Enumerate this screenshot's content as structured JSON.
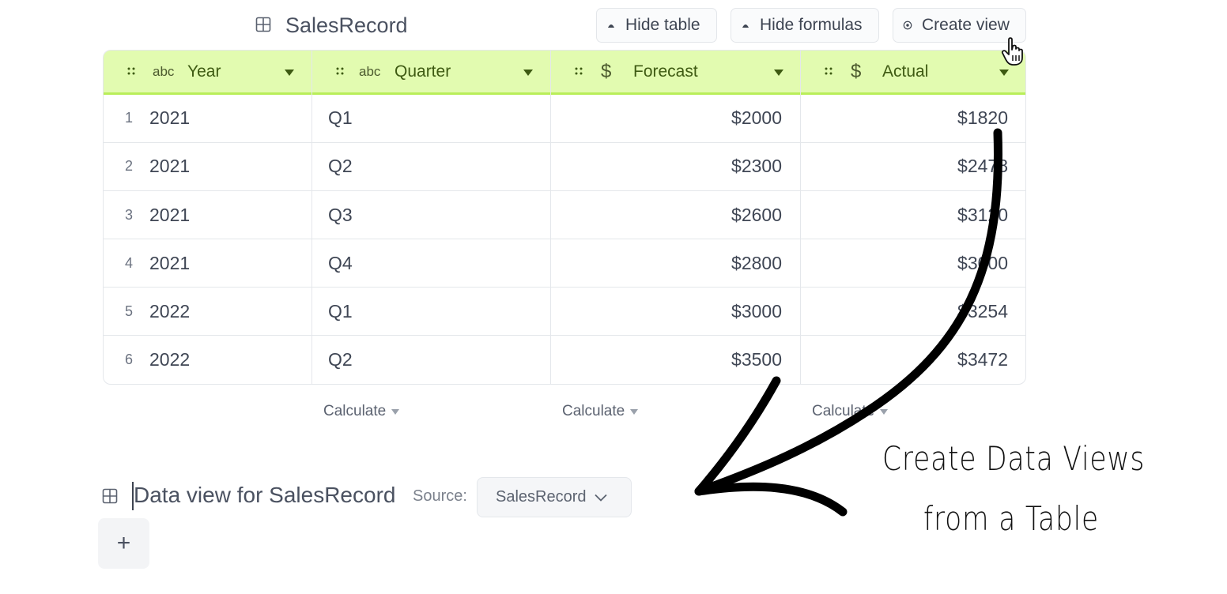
{
  "table": {
    "title": "SalesRecord",
    "buttons": {
      "hide_table": "Hide table",
      "hide_formulas": "Hide formulas",
      "create_view": "Create view"
    },
    "columns": [
      {
        "type_label": "abc",
        "type_icon": "text-type",
        "name": "Year"
      },
      {
        "type_label": "abc",
        "type_icon": "text-type",
        "name": "Quarter"
      },
      {
        "type_label": "$",
        "type_icon": "currency-type",
        "name": "Forecast"
      },
      {
        "type_label": "$",
        "type_icon": "currency-type",
        "name": "Actual"
      }
    ],
    "rows": [
      {
        "n": "1",
        "year": "2021",
        "quarter": "Q1",
        "forecast": "$2000",
        "actual": "$1820"
      },
      {
        "n": "2",
        "year": "2021",
        "quarter": "Q2",
        "forecast": "$2300",
        "actual": "$2478"
      },
      {
        "n": "3",
        "year": "2021",
        "quarter": "Q3",
        "forecast": "$2600",
        "actual": "$3120"
      },
      {
        "n": "4",
        "year": "2021",
        "quarter": "Q4",
        "forecast": "$2800",
        "actual": "$3000"
      },
      {
        "n": "5",
        "year": "2022",
        "quarter": "Q1",
        "forecast": "$3000",
        "actual": "$3254"
      },
      {
        "n": "6",
        "year": "2022",
        "quarter": "Q2",
        "forecast": "$3500",
        "actual": "$3472"
      }
    ],
    "footer": {
      "calculate": "Calculate"
    }
  },
  "data_view": {
    "title": "Data view for SalesRecord",
    "source_label": "Source:",
    "source_value": "SalesRecord",
    "add_symbol": "+"
  },
  "annotation": {
    "line1": "Create Data Views",
    "line2": "from a Table"
  },
  "colors": {
    "header_bg": "#e2fbb0",
    "header_accent": "#b9ee5a",
    "header_text": "#3e5a12"
  }
}
